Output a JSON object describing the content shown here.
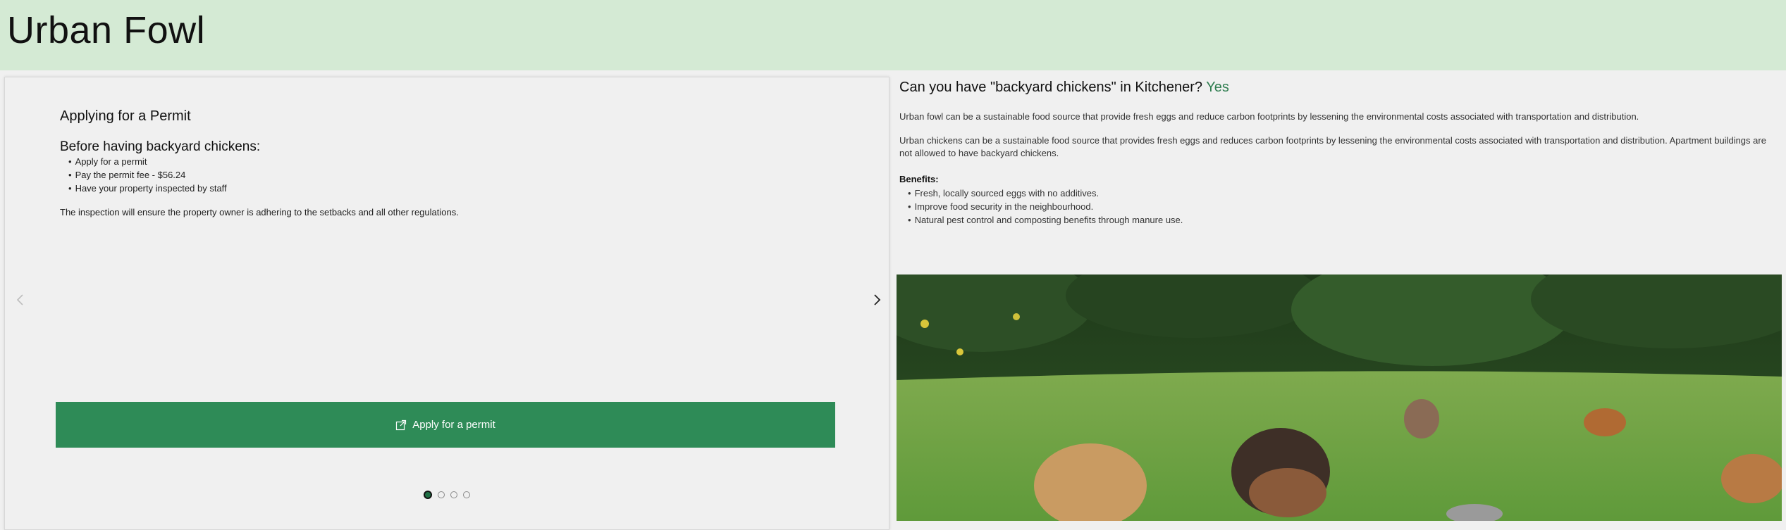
{
  "header": {
    "title": "Urban Fowl"
  },
  "slide": {
    "title": "Applying for a Permit",
    "subtitle": "Before having backyard chickens:",
    "steps": [
      "Apply for a permit",
      "Pay the permit fee - $56.24",
      "Have your property inspected by staff"
    ],
    "note": "The inspection will ensure the property owner is adhering to the setbacks and all other regulations."
  },
  "apply_button": {
    "label": "Apply for a permit",
    "icon": "external-link-icon"
  },
  "carousel": {
    "total": 4,
    "current": 1,
    "prev_icon": "chevron-left-icon",
    "next_icon": "chevron-right-icon"
  },
  "info": {
    "question": "Can you have \"backyard chickens\" in Kitchener?",
    "answer": "Yes",
    "paragraph1": "Urban fowl can be a sustainable food source that provide fresh eggs and reduce carbon footprints by lessening the environmental costs associated with transportation and distribution.",
    "paragraph2": "Urban chickens can be a sustainable food source that provides fresh eggs and reduces carbon footprints by lessening the environmental costs associated with transportation and distribution. Apartment buildings are not allowed to have backyard chickens.",
    "benefits_label": "Benefits:",
    "benefits": [
      "Fresh, locally sourced eggs with no additives.",
      "Improve food security in the neighbourhood.",
      "Natural pest control and composting benefits through manure use."
    ]
  },
  "colors": {
    "header_bg": "#d4ead4",
    "accent": "#2e8b57",
    "answer": "#2e7d4f"
  }
}
